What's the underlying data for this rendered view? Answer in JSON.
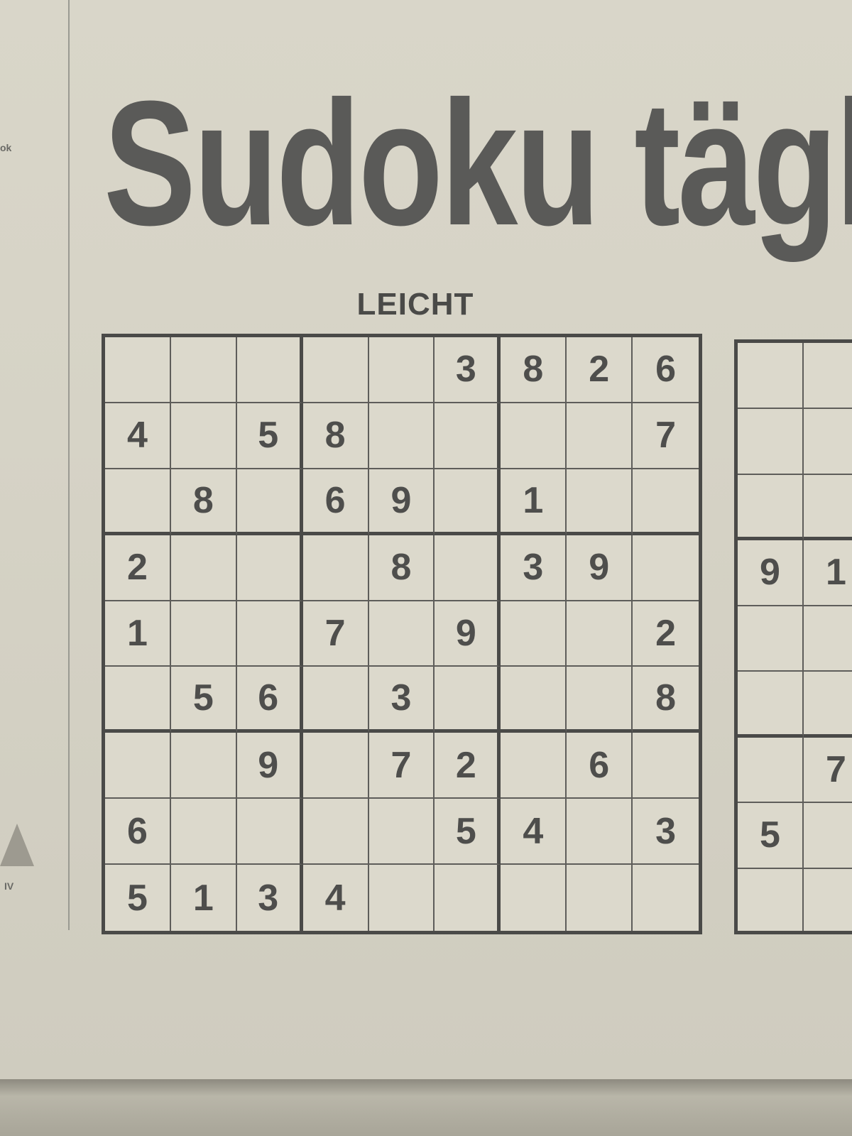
{
  "headline": "Sudoku tägli",
  "difficulty": "LEICHT",
  "grid": [
    [
      "",
      "",
      "",
      "",
      "",
      "3",
      "8",
      "2",
      "6"
    ],
    [
      "4",
      "",
      "5",
      "8",
      "",
      "",
      "",
      "",
      "7"
    ],
    [
      "",
      "8",
      "",
      "6",
      "9",
      "",
      "1",
      "",
      ""
    ],
    [
      "2",
      "",
      "",
      "",
      "8",
      "",
      "3",
      "9",
      ""
    ],
    [
      "1",
      "",
      "",
      "7",
      "",
      "9",
      "",
      "",
      "2"
    ],
    [
      "",
      "5",
      "6",
      "",
      "3",
      "",
      "",
      "",
      "8"
    ],
    [
      "",
      "",
      "9",
      "",
      "7",
      "2",
      "",
      "6",
      ""
    ],
    [
      "6",
      "",
      "",
      "",
      "",
      "5",
      "4",
      "",
      "3"
    ],
    [
      "5",
      "1",
      "3",
      "4",
      "",
      "",
      "",
      "",
      ""
    ]
  ],
  "second_grid_partial": [
    [
      "",
      ""
    ],
    [
      "",
      ""
    ],
    [
      "",
      ""
    ],
    [
      "9",
      "1"
    ],
    [
      "",
      ""
    ],
    [
      "",
      ""
    ],
    [
      "",
      "7"
    ],
    [
      "5",
      ""
    ],
    [
      "",
      ""
    ]
  ]
}
